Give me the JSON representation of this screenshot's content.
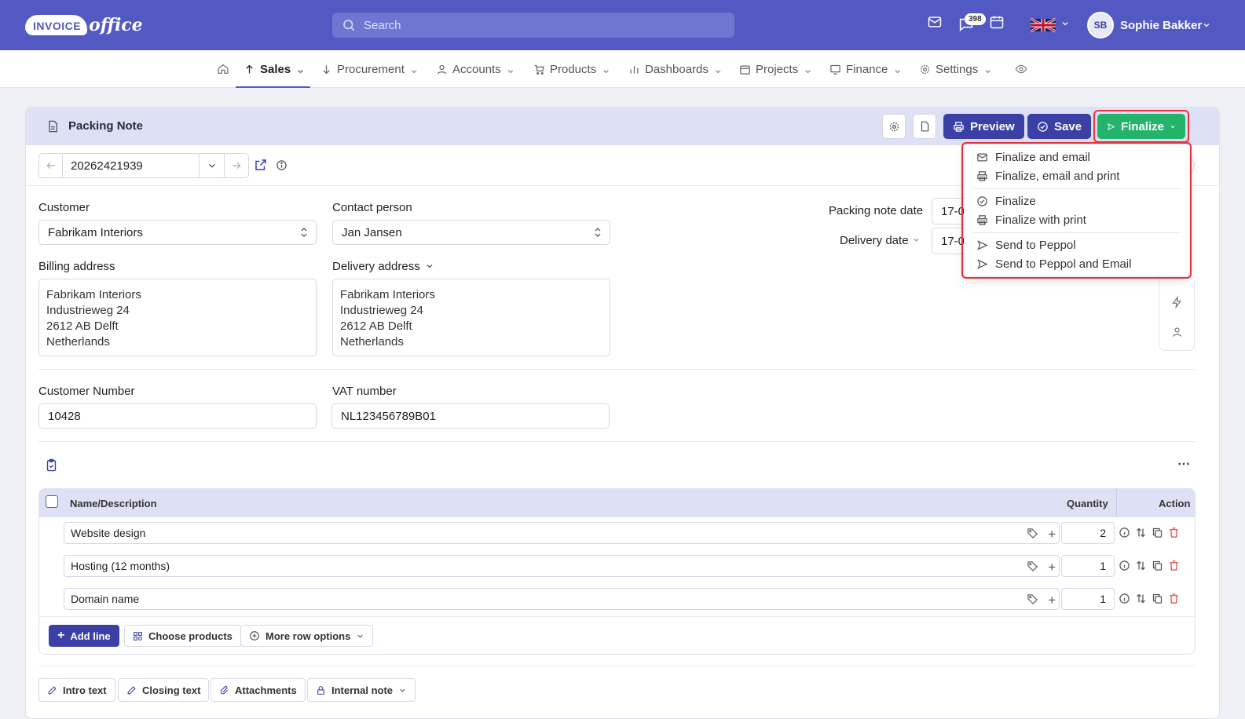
{
  "topbar": {
    "logo_text_1": "INVOICE",
    "logo_text_2": "office",
    "search_placeholder": "Search",
    "notif_count": "398",
    "user_initials": "SB",
    "user_name": "Sophie Bakker",
    "language_flag": "uk-flag"
  },
  "nav": {
    "items": [
      {
        "label": "Sales",
        "icon": "arrow-up-icon"
      },
      {
        "label": "Procurement",
        "icon": "arrow-down-icon"
      },
      {
        "label": "Accounts",
        "icon": "user-icon"
      },
      {
        "label": "Products",
        "icon": "cart-icon"
      },
      {
        "label": "Dashboards",
        "icon": "bar-chart-icon"
      },
      {
        "label": "Projects",
        "icon": "calendar-icon"
      },
      {
        "label": "Finance",
        "icon": "monitor-icon"
      },
      {
        "label": "Settings",
        "icon": "gear-icon"
      }
    ]
  },
  "doc": {
    "title": "Packing Note",
    "preview_label": "Preview",
    "save_label": "Save",
    "finalize_label": "Finalize",
    "number": "20262421939"
  },
  "finalize_menu": [
    "Finalize and email",
    "Finalize, email and print",
    "Finalize",
    "Finalize with print",
    "Send to Peppol",
    "Send to Peppol and Email"
  ],
  "form": {
    "customer_label": "Customer",
    "customer_value": "Fabrikam Interiors",
    "contact_label": "Contact person",
    "contact_value": "Jan Jansen",
    "packing_date_label": "Packing note date",
    "packing_date_value": "17-0",
    "delivery_date_label": "Delivery date",
    "delivery_date_value": "17-0",
    "billing_label": "Billing address",
    "billing_lines": [
      "Fabrikam Interiors",
      "Industrieweg 24",
      "2612 AB Delft",
      "Netherlands"
    ],
    "delivery_label": "Delivery address",
    "delivery_lines": [
      "Fabrikam Interiors",
      "Industrieweg 24",
      "2612 AB Delft",
      "Netherlands"
    ],
    "customer_number_label": "Customer Number",
    "customer_number_value": "10428",
    "vat_label": "VAT number",
    "vat_value": "NL123456789B01"
  },
  "table": {
    "col_name": "Name/Description",
    "col_qty": "Quantity",
    "col_action": "Action",
    "rows": [
      {
        "name": "Website design",
        "qty": "2"
      },
      {
        "name": "Hosting (12 months)",
        "qty": "1"
      },
      {
        "name": "Domain name",
        "qty": "1"
      }
    ],
    "add_line": "Add line",
    "choose_products": "Choose products",
    "more_row_options": "More row options"
  },
  "bottom_tabs": [
    "Intro text",
    "Closing text",
    "Attachments",
    "Internal note"
  ],
  "colors": {
    "brand": "#5259c3",
    "primary": "#3b40a6",
    "finalize": "#23b36a",
    "highlight": "#e8313c"
  }
}
